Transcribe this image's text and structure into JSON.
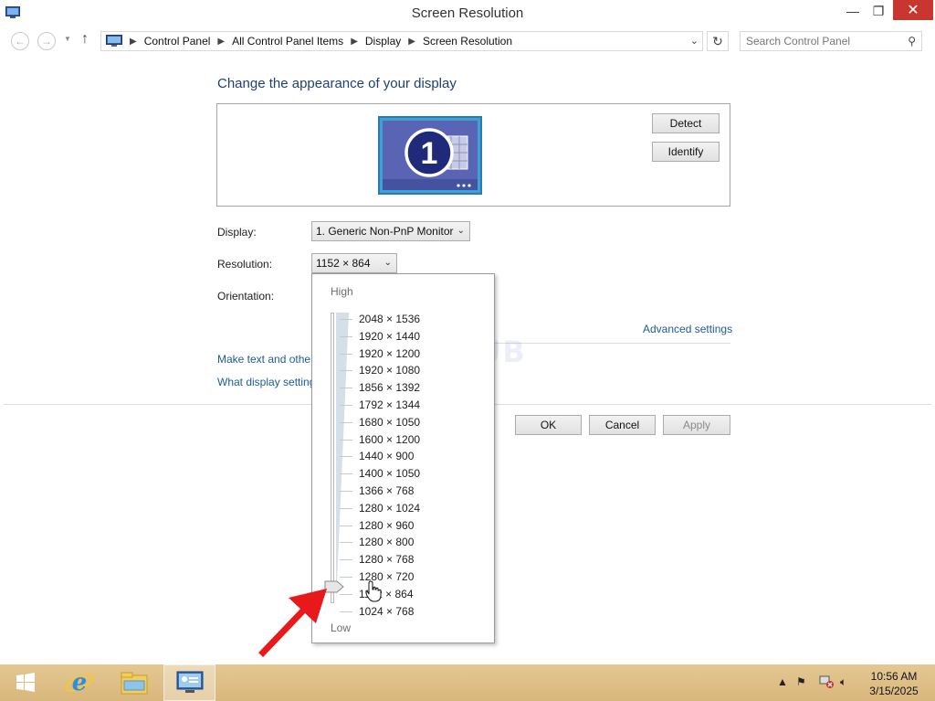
{
  "window": {
    "title": "Screen Resolution",
    "minimize_glyph": "—",
    "maximize_glyph": "❐",
    "close_glyph": "✕"
  },
  "address_bar": {
    "breadcrumbs": [
      "Control Panel",
      "All Control Panel Items",
      "Display",
      "Screen Resolution"
    ],
    "search_placeholder": "Search Control Panel"
  },
  "main": {
    "heading": "Change the appearance of your display",
    "monitor_number": "1",
    "detect_label": "Detect",
    "identify_label": "Identify",
    "display_label": "Display:",
    "display_value": "1. Generic Non-PnP Monitor",
    "resolution_label": "Resolution:",
    "resolution_value": "1152 × 864",
    "orientation_label": "Orientation:",
    "advanced_settings": "Advanced settings",
    "link_text_size": "Make text and other",
    "link_display_settings": "What display setting",
    "ok_label": "OK",
    "cancel_label": "Cancel",
    "apply_label": "Apply",
    "watermark": "FiproSHUB"
  },
  "resolution_popup": {
    "high_label": "High",
    "low_label": "Low",
    "options": [
      "2048 × 1536",
      "1920 × 1440",
      "1920 × 1200",
      "1920 × 1080",
      "1856 × 1392",
      "1792 × 1344",
      "1680 × 1050",
      "1600 × 1200",
      "1440 × 900",
      "1400 × 1050",
      "1366 × 768",
      "1280 × 1024",
      "1280 × 960",
      "1280 × 800",
      "1280 × 768",
      "1280 × 720",
      "1152 × 864",
      "1024 × 768"
    ],
    "selected": "1152 × 864"
  },
  "taskbar": {
    "items": [
      "start-icon",
      "internet-explorer-icon",
      "file-explorer-icon",
      "control-panel-icon"
    ],
    "clock_time": "10:56 AM",
    "clock_date": "3/15/2025"
  },
  "colors": {
    "accent_link": "#1e5b9c",
    "heading": "#1e3f74",
    "close_button": "#c7372f",
    "taskbar": "#dcbb80",
    "annotation_arrow": "#e8191b"
  }
}
